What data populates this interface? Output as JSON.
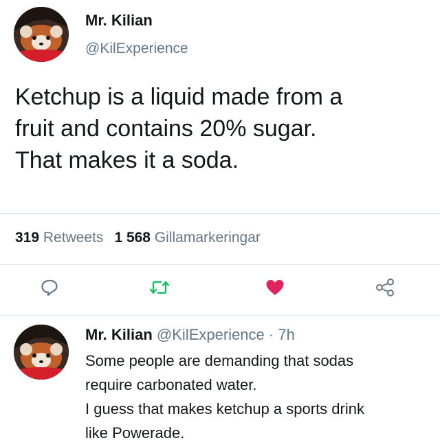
{
  "tweet": {
    "author_name": "Mr. Kilian",
    "author_handle": "@KilExperience",
    "text_lines": [
      "Ketchup is a liquid made from a",
      "fruit and contains 20% sugar.",
      "That makes it a soda."
    ],
    "retweet_count": "319",
    "retweet_label": "Retweets",
    "like_count": "1 568",
    "like_label": "Gillamarkeringar"
  },
  "actions": {
    "icons": [
      "reply-icon",
      "retweet-icon",
      "heart-icon",
      "share-icon"
    ],
    "retweet_color": "#17bf63",
    "like_color": "#e0245e"
  },
  "reply": {
    "author_name": "Mr. Kilian",
    "author_handle": "@KilExperience",
    "separator": "·",
    "time": "7h",
    "text_lines": [
      "Some people are demanding that sodas",
      "require carbonated water.",
      "I guess that makes ketchup a sports drink",
      "like Powerade."
    ]
  }
}
